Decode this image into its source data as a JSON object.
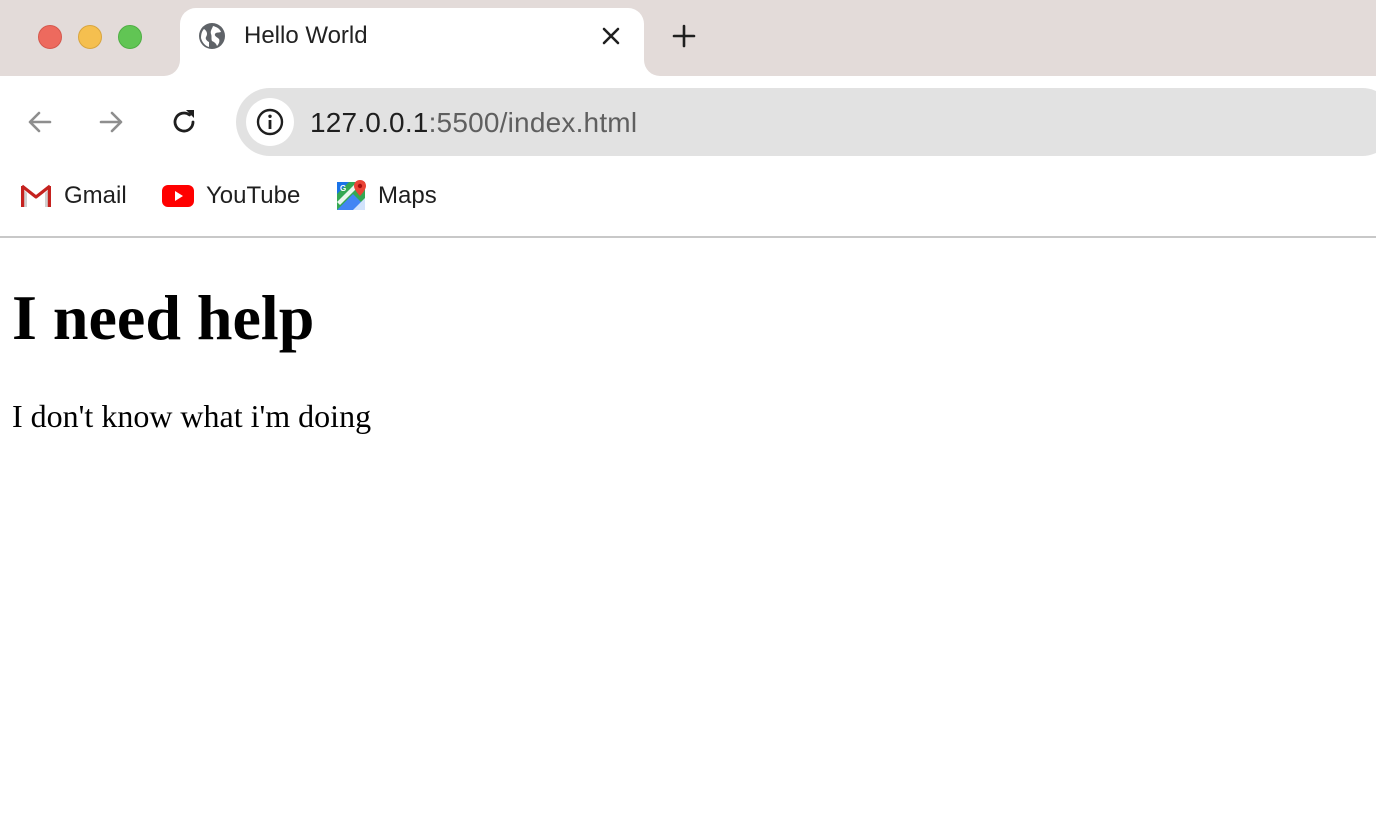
{
  "window": {
    "controls": [
      "close",
      "minimize",
      "maximize"
    ],
    "colors": {
      "close": "#ed6a5e",
      "minimize": "#f5bf4f",
      "maximize": "#61c554"
    }
  },
  "tab": {
    "title": "Hello World",
    "favicon": "globe-icon"
  },
  "toolbar": {
    "url_host": "127.0.0.1",
    "url_rest": ":5500/index.html",
    "site_info_icon": "info-icon"
  },
  "bookmarks": [
    {
      "label": "Gmail",
      "icon": "gmail-icon"
    },
    {
      "label": "YouTube",
      "icon": "youtube-icon"
    },
    {
      "label": "Maps",
      "icon": "maps-icon"
    }
  ],
  "page": {
    "heading": "I need help",
    "paragraph": "I don't know what i'm doing"
  }
}
